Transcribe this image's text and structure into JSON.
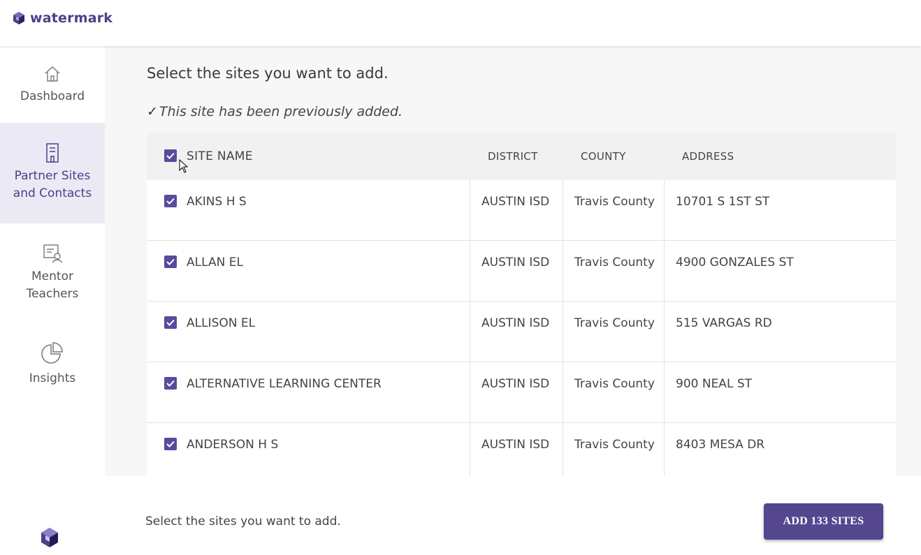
{
  "brand": {
    "name": "watermark"
  },
  "sidebar": {
    "items": [
      {
        "label": "Dashboard",
        "icon": "home-icon",
        "active": false
      },
      {
        "label": "Partner Sites and Contacts",
        "icon": "building-icon",
        "active": true
      },
      {
        "label": "Mentor Teachers",
        "icon": "certificate-user-icon",
        "active": false
      },
      {
        "label": "Insights",
        "icon": "pie-chart-icon",
        "active": false
      }
    ]
  },
  "main": {
    "heading": "Select the sites you want to add.",
    "note": "This site has been previously added.",
    "table": {
      "columns": {
        "site_name": "SITE NAME",
        "district": "DISTRICT",
        "county": "COUNTY",
        "address": "ADDRESS"
      },
      "select_all_checked": true,
      "rows": [
        {
          "checked": true,
          "site_name": "AKINS H S",
          "district": "AUSTIN ISD",
          "county": "Travis County",
          "address": "10701 S 1ST ST"
        },
        {
          "checked": true,
          "site_name": "ALLAN EL",
          "district": "AUSTIN ISD",
          "county": "Travis County",
          "address": "4900 GONZALES ST"
        },
        {
          "checked": true,
          "site_name": "ALLISON EL",
          "district": "AUSTIN ISD",
          "county": "Travis County",
          "address": "515 VARGAS RD"
        },
        {
          "checked": true,
          "site_name": "ALTERNATIVE LEARNING CENTER",
          "district": "AUSTIN ISD",
          "county": "Travis County",
          "address": "900 NEAL ST"
        },
        {
          "checked": true,
          "site_name": "ANDERSON H S",
          "district": "AUSTIN ISD",
          "county": "Travis County",
          "address": "8403 MESA DR"
        }
      ]
    }
  },
  "footer": {
    "text": "Select the sites you want to add.",
    "add_button": "ADD 133 SITES"
  },
  "colors": {
    "accent": "#54468f",
    "checkbox": "#5a4a9c",
    "active_nav_bg": "#ebe9f3"
  }
}
